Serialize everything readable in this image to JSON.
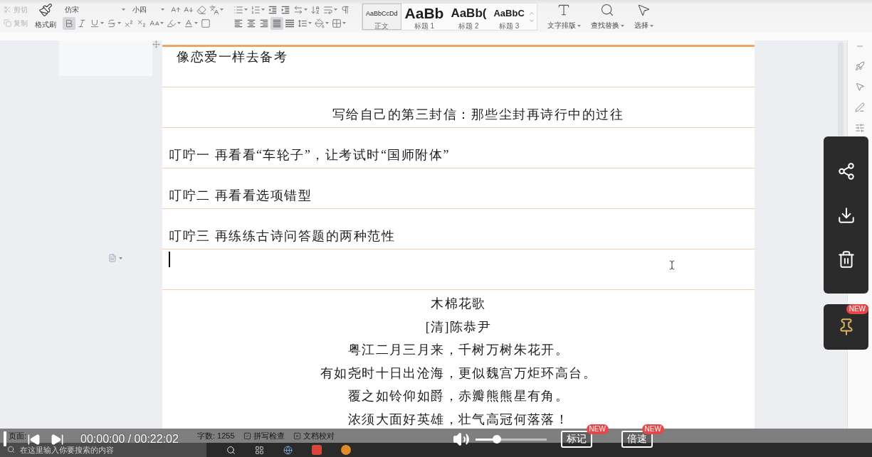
{
  "ribbon": {
    "clipboard": [
      {
        "kind": "cut",
        "label": "剪切",
        "disabled": true
      },
      {
        "kind": "copy",
        "label": "复制",
        "disabled": true
      }
    ],
    "format_painter": {
      "label": "格式刷"
    },
    "font_name": {
      "value": "仿宋"
    },
    "font_size": {
      "value": "小四"
    },
    "char_format": [
      {
        "kind": "bold",
        "on": true
      },
      {
        "kind": "italic",
        "on": false
      },
      {
        "kind": "underline",
        "on": false
      },
      {
        "kind": "strikethrough",
        "on": false
      },
      {
        "kind": "superscript",
        "on": false
      },
      {
        "kind": "subscript",
        "on": false
      }
    ],
    "alignment": [
      {
        "kind": "left",
        "selected": false
      },
      {
        "kind": "center",
        "selected": false
      },
      {
        "kind": "right",
        "selected": false
      },
      {
        "kind": "justify",
        "selected": true
      },
      {
        "kind": "distributed",
        "selected": false
      }
    ],
    "styles": [
      {
        "kind": "body",
        "preview": "AaBbCcDd",
        "label": "正文",
        "selected": true
      },
      {
        "kind": "heading1",
        "preview": "AaBb",
        "label": "标题 1",
        "selected": false
      },
      {
        "kind": "heading2",
        "preview": "AaBb(",
        "label": "标题 2",
        "selected": false
      },
      {
        "kind": "heading3",
        "preview": "AaBbC",
        "label": "标题 3",
        "selected": false
      }
    ],
    "tools": [
      {
        "kind": "layout",
        "label": "文字排版"
      },
      {
        "kind": "find",
        "label": "查找替换"
      },
      {
        "kind": "select",
        "label": "选择"
      }
    ]
  },
  "document": {
    "rows": [
      {
        "kind": "heading",
        "text": "像恋爱一样去备考"
      },
      {
        "kind": "title",
        "text": "写给自己的第三封信：那些尘封再诗行中的过往"
      },
      {
        "kind": "item",
        "text": "叮咛一 再看看“车轮子”，让考试时“国师附体”"
      },
      {
        "kind": "item",
        "text": "叮咛二 再看看选项错型"
      },
      {
        "kind": "item",
        "text": "叮咛三 再练练古诗问答题的两种范性"
      },
      {
        "kind": "cursor"
      },
      {
        "kind": "poem",
        "title": "木棉花歌",
        "author": "[清]陈恭尹",
        "lines": [
          "粤江二月三月来，千树万树朱花开。",
          "有如尧时十日出沧海，更似魏宫万炬环高台。",
          "覆之如铃仰如爵，赤瓣熊熊星有角。",
          "浓须大面好英雄，壮气高冠何落落！"
        ]
      }
    ]
  },
  "status_bar": {
    "items": [
      {
        "kind": "page",
        "label": "页面:"
      },
      {
        "kind": "count",
        "label": "字数: 1255"
      },
      {
        "kind": "spellcheck",
        "label": "拼写检查"
      },
      {
        "kind": "proofread",
        "label": "文档校对"
      }
    ]
  },
  "taskbar": {
    "search": {
      "placeholder": "在这里输入你要搜索的内容"
    }
  },
  "player": {
    "progress": {
      "level": 0
    },
    "time": "00:00:00 / 00:22:02",
    "volume": {
      "level": 0.3
    },
    "buttons": [
      {
        "label": "标记",
        "badge": "NEW"
      },
      {
        "label": "倍速",
        "badge": "NEW"
      }
    ]
  },
  "side_panel": {
    "pin": {
      "badge": "NEW"
    }
  }
}
